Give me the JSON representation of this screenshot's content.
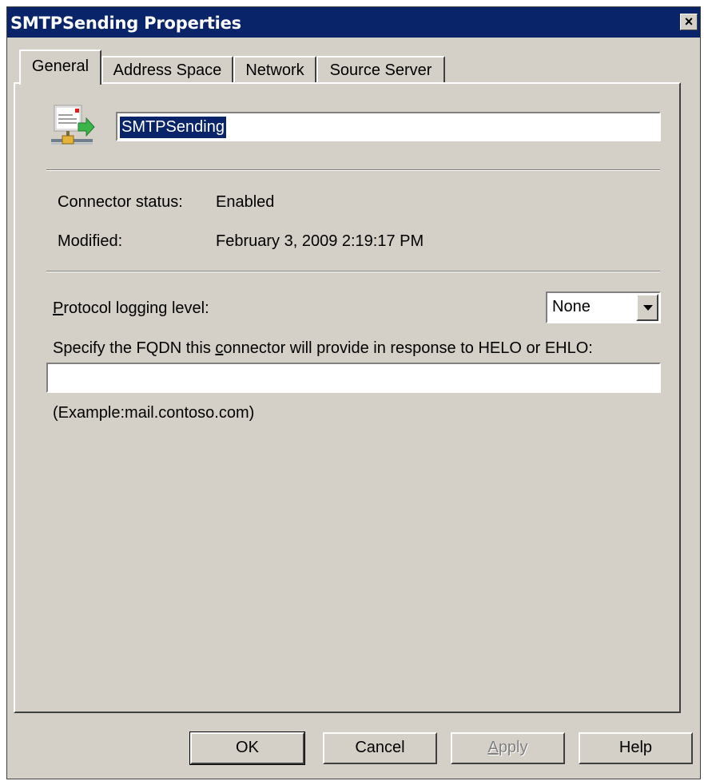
{
  "window": {
    "title": "SMTPSending Properties",
    "close_glyph": "×"
  },
  "tabs": [
    {
      "label": "General",
      "active": true
    },
    {
      "label": "Address Space",
      "active": false
    },
    {
      "label": "Network",
      "active": false
    },
    {
      "label": "Source Server",
      "active": false
    }
  ],
  "general": {
    "connector_icon": "send-connector-icon",
    "name_value": "SMTPSending",
    "status_label": "Connector status:",
    "status_value": "Enabled",
    "modified_label": "Modified:",
    "modified_value": "February 3, 2009 2:19:17 PM",
    "logging_label_first": "P",
    "logging_label_rest": "rotocol logging level:",
    "logging_value": "None",
    "fqdn_label_pre": "Specify the FQDN this ",
    "fqdn_label_u": "c",
    "fqdn_label_post": "onnector will provide in response to HELO or EHLO:",
    "fqdn_value": "",
    "example_text": "(Example:mail.contoso.com)"
  },
  "buttons": {
    "ok": "OK",
    "cancel": "Cancel",
    "apply_first": "A",
    "apply_rest": "pply",
    "help": "Help"
  },
  "colors": {
    "titlebar": "#0a246a",
    "face": "#d4d0c8"
  }
}
